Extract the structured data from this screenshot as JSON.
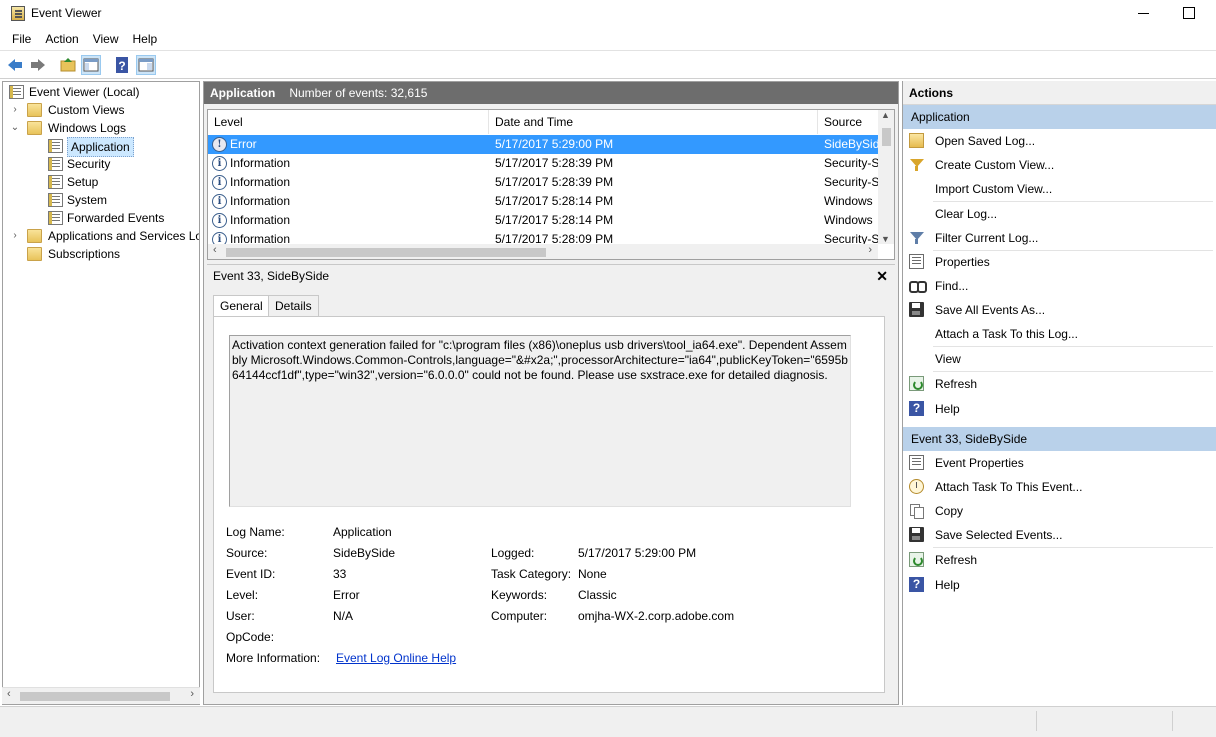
{
  "window": {
    "title": "Event Viewer"
  },
  "menu": [
    "File",
    "Action",
    "View",
    "Help"
  ],
  "tree": {
    "root": "Event Viewer (Local)",
    "custom_views": "Custom Views",
    "windows_logs": "Windows Logs",
    "logs": [
      "Application",
      "Security",
      "Setup",
      "System",
      "Forwarded Events"
    ],
    "apps_services": "Applications and Services Lo",
    "subscriptions": "Subscriptions"
  },
  "middle": {
    "header_title": "Application",
    "header_count": "Number of events: 32,615",
    "columns": [
      "Level",
      "Date and Time",
      "Source"
    ],
    "rows": [
      {
        "level": "Error",
        "date": "5/17/2017 5:29:00 PM",
        "source": "SideBySide",
        "icon": "error-icon"
      },
      {
        "level": "Information",
        "date": "5/17/2017 5:28:39 PM",
        "source": "Security-S",
        "icon": "info-icon"
      },
      {
        "level": "Information",
        "date": "5/17/2017 5:28:39 PM",
        "source": "Security-S",
        "icon": "info-icon"
      },
      {
        "level": "Information",
        "date": "5/17/2017 5:28:14 PM",
        "source": "Windows",
        "icon": "info-icon"
      },
      {
        "level": "Information",
        "date": "5/17/2017 5:28:14 PM",
        "source": "Windows",
        "icon": "info-icon"
      },
      {
        "level": "Information",
        "date": "5/17/2017 5:28:09 PM",
        "source": "Security-S",
        "icon": "info-icon"
      }
    ],
    "detail_title": "Event 33, SideBySide",
    "tabs": [
      "General",
      "Details"
    ],
    "description": "Activation context generation failed for \"c:\\program files (x86)\\oneplus usb drivers\\tool_ia64.exe\". Dependent Assembly Microsoft.Windows.Common-Controls,language=\"&#x2a;\",processorArchitecture=\"ia64\",publicKeyToken=\"6595b64144ccf1df\",type=\"win32\",version=\"6.0.0.0\" could not be found. Please use sxstrace.exe for detailed diagnosis.",
    "fields": {
      "log_name_label": "Log Name:",
      "log_name": "Application",
      "source_label": "Source:",
      "source": "SideBySide",
      "logged_label": "Logged:",
      "logged": "5/17/2017 5:29:00 PM",
      "event_id_label": "Event ID:",
      "event_id": "33",
      "task_category_label": "Task Category:",
      "task_category": "None",
      "level_label": "Level:",
      "level": "Error",
      "keywords_label": "Keywords:",
      "keywords": "Classic",
      "user_label": "User:",
      "user": "N/A",
      "computer_label": "Computer:",
      "computer": "omjha-WX-2.corp.adobe.com",
      "opcode_label": "OpCode:",
      "more_info_label": "More Information:",
      "more_info_link": "Event Log Online Help"
    }
  },
  "actions": {
    "title": "Actions",
    "section1": "Application",
    "items1": [
      {
        "label": "Open Saved Log...",
        "icon": "open-folder-icon"
      },
      {
        "label": "Create Custom View...",
        "icon": "filter-icon"
      },
      {
        "label": "Import Custom View...",
        "icon": ""
      },
      {
        "label": "Clear Log...",
        "icon": ""
      },
      {
        "label": "Filter Current Log...",
        "icon": "filter-icon"
      },
      {
        "label": "Properties",
        "icon": "properties-icon"
      },
      {
        "label": "Find...",
        "icon": "binoculars-icon"
      },
      {
        "label": "Save All Events As...",
        "icon": "save-icon"
      },
      {
        "label": "Attach a Task To this Log...",
        "icon": ""
      },
      {
        "label": "View",
        "icon": ""
      },
      {
        "label": "Refresh",
        "icon": "refresh-icon"
      },
      {
        "label": "Help",
        "icon": "help-icon"
      }
    ],
    "section2": "Event 33, SideBySide",
    "items2": [
      {
        "label": "Event Properties",
        "icon": "properties-icon"
      },
      {
        "label": "Attach Task To This Event...",
        "icon": "task-icon"
      },
      {
        "label": "Copy",
        "icon": "copy-icon"
      },
      {
        "label": "Save Selected Events...",
        "icon": "save-icon"
      },
      {
        "label": "Refresh",
        "icon": "refresh-icon"
      },
      {
        "label": "Help",
        "icon": "help-icon"
      }
    ]
  },
  "colors": {
    "selection": "#3399ff",
    "section_header": "#b9d1ea",
    "pane_header": "#6d6d6d",
    "link": "#0033cc"
  }
}
